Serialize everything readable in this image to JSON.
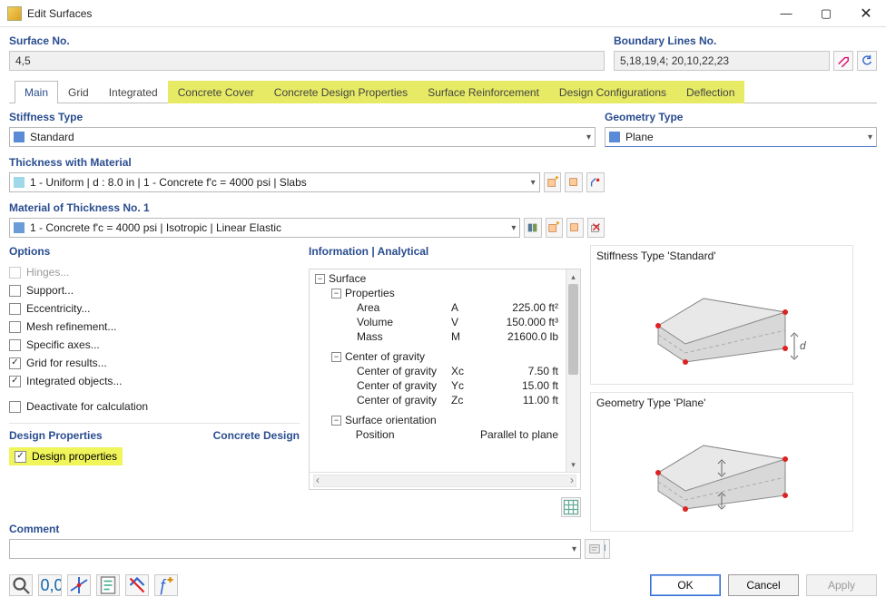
{
  "window": {
    "title": "Edit Surfaces"
  },
  "surface_no": {
    "label": "Surface No.",
    "value": "4,5"
  },
  "boundary": {
    "label": "Boundary Lines No.",
    "value": "5,18,19,4; 20,10,22,23"
  },
  "tabs": {
    "main": "Main",
    "grid": "Grid",
    "integrated": "Integrated",
    "concrete_cover": "Concrete Cover",
    "concrete_design_props": "Concrete Design Properties",
    "surface_reinforcement": "Surface Reinforcement",
    "design_config": "Design Configurations",
    "deflection": "Deflection"
  },
  "stiffness": {
    "label": "Stiffness Type",
    "value": "Standard"
  },
  "geometry": {
    "label": "Geometry Type",
    "value": "Plane"
  },
  "thickness": {
    "label": "Thickness with Material",
    "value": "1 - Uniform | d : 8.0 in | 1 - Concrete f'c = 4000 psi | Slabs"
  },
  "material": {
    "label": "Material of Thickness No. 1",
    "value": "1 - Concrete f'c = 4000 psi | Isotropic | Linear Elastic"
  },
  "options": {
    "label": "Options",
    "hinges": "Hinges...",
    "support": "Support...",
    "eccentricity": "Eccentricity...",
    "mesh": "Mesh refinement...",
    "axes": "Specific axes...",
    "grid_results": "Grid for results...",
    "integrated": "Integrated objects...",
    "deactivate": "Deactivate for calculation"
  },
  "design": {
    "label": "Design Properties",
    "right_label": "Concrete Design",
    "checkbox": "Design properties"
  },
  "info": {
    "label": "Information | Analytical",
    "surface": "Surface",
    "properties": "Properties",
    "area_l": "Area",
    "area_s": "A",
    "area_v": "225.00 ft²",
    "vol_l": "Volume",
    "vol_s": "V",
    "vol_v": "150.000 ft³",
    "mass_l": "Mass",
    "mass_s": "M",
    "mass_v": "21600.0 lb",
    "cog": "Center of gravity",
    "cog1_l": "Center of gravity",
    "cog1_s": "Xc",
    "cog1_v": "7.50 ft",
    "cog2_l": "Center of gravity",
    "cog2_s": "Yc",
    "cog2_v": "15.00 ft",
    "cog3_l": "Center of gravity",
    "cog3_s": "Zc",
    "cog3_v": "11.00 ft",
    "orient": "Surface orientation",
    "pos_l": "Position",
    "pos_v": "Parallel to plane"
  },
  "comment": {
    "label": "Comment",
    "value": ""
  },
  "preview": {
    "stiff": "Stiffness Type 'Standard'",
    "geom": "Geometry Type 'Plane'"
  },
  "footer": {
    "ok": "OK",
    "cancel": "Cancel",
    "apply": "Apply"
  }
}
